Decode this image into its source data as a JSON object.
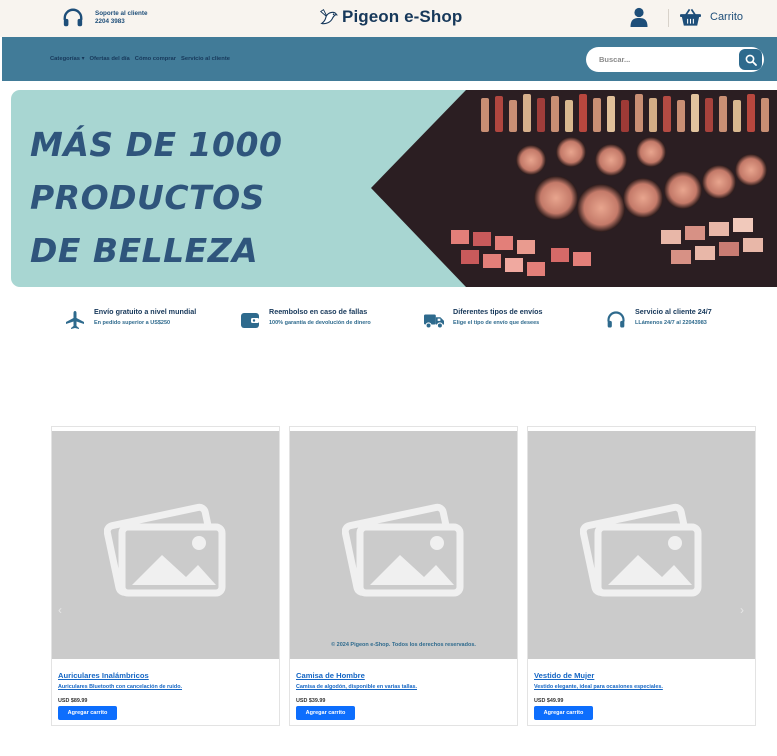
{
  "topbar": {
    "support_line1": "Soporte al cliente",
    "support_line2": "2204 3983",
    "brand": "Pigeon e-Shop",
    "cart_label": "Carrito"
  },
  "nav": {
    "links": [
      "Categorías ▾",
      "Ofertas del día",
      "Cómo comprar",
      "Servicio al cliente"
    ],
    "search_placeholder": "Buscar..."
  },
  "hero": {
    "lines": [
      "MÁS DE 1000",
      "PRODUCTOS",
      "DE BELLEZA"
    ]
  },
  "features": [
    {
      "icon": "airplane-icon",
      "title": "Envío gratuito a nivel mundial",
      "subtitle": "En pedido superior a US$250"
    },
    {
      "icon": "wallet-icon",
      "title": "Reembolso en caso de fallas",
      "subtitle": "100% garantía de devolución de dinero"
    },
    {
      "icon": "truck-icon",
      "title": "Diferentes tipos de envíos",
      "subtitle": "Elige el tipo de envío que desees"
    },
    {
      "icon": "headset-icon",
      "title": "Servicio al cliente 24/7",
      "subtitle": "LLámenos 24/7 al 22043983"
    }
  ],
  "products": [
    {
      "name": "Auriculares Inalámbricos",
      "description": "Auriculares Bluetooth con cancelación de ruido.",
      "price": "USD $89.99",
      "button": "Agregar carrito"
    },
    {
      "name": "Camisa de Hombre",
      "description": "Camisa de algodón, disponible en varias tallas.",
      "price": "USD $39.99",
      "button": "Agregar carrito"
    },
    {
      "name": "Vestido de Mujer",
      "description": "Vestido elegante, ideal para ocasiones especiales.",
      "price": "USD $49.99",
      "button": "Agregar carrito"
    }
  ],
  "footer_note": "© 2024 Pigeon e-Shop. Todos los derechos reservados.",
  "carousel": {
    "prev": "‹",
    "next": "›"
  },
  "colors": {
    "nav": "#417b98",
    "hero_bg": "#a8d6d2",
    "headline": "#2f557c",
    "button": "#0d6efd",
    "link": "#1566c4"
  }
}
